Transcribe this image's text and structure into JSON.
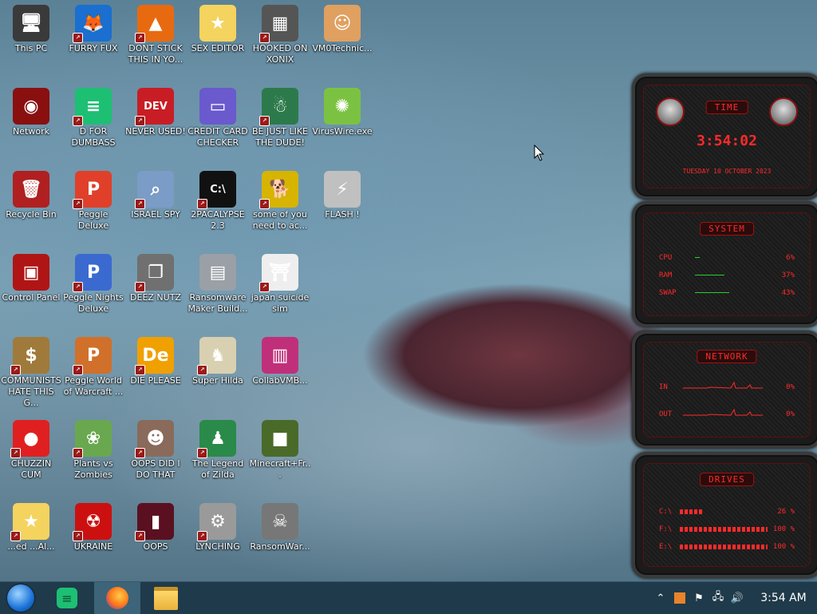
{
  "desktop": {
    "icons": [
      {
        "label": "This PC",
        "glyph": "🖥",
        "color": "#3a3a3a",
        "col": 0,
        "row": 0,
        "shortcut": false
      },
      {
        "label": "FURRY FUX",
        "glyph": "🦊",
        "color": "#1a6fd0",
        "col": 1,
        "row": 0,
        "shortcut": true
      },
      {
        "label": "DONT STICK THIS IN YO...",
        "glyph": "▲",
        "color": "#e86a10",
        "col": 2,
        "row": 0,
        "shortcut": true
      },
      {
        "label": "SEX EDITOR",
        "glyph": "★",
        "color": "#f4d35e",
        "col": 3,
        "row": 0,
        "shortcut": false
      },
      {
        "label": "HOOKED ON XONIX",
        "glyph": "▦",
        "color": "#555555",
        "col": 4,
        "row": 0,
        "shortcut": true
      },
      {
        "label": "VM0Technic...",
        "glyph": "☺",
        "color": "#e0a060",
        "col": 5,
        "row": 0,
        "shortcut": false
      },
      {
        "label": "Network",
        "glyph": "◉",
        "color": "#8a1010",
        "col": 0,
        "row": 1,
        "shortcut": false
      },
      {
        "label": "D FOR DUMBASS",
        "glyph": "≡",
        "color": "#1dbf73",
        "col": 1,
        "row": 1,
        "shortcut": true
      },
      {
        "label": "NEVER USED!",
        "glyph": "DEV",
        "color": "#c81d25",
        "col": 2,
        "row": 1,
        "shortcut": true
      },
      {
        "label": "CREDIT CARD CHECKER",
        "glyph": "▭",
        "color": "#6a5acd",
        "col": 3,
        "row": 1,
        "shortcut": false
      },
      {
        "label": "BE JUST LIKE THE DUDE!",
        "glyph": "☃",
        "color": "#2c7a4b",
        "col": 4,
        "row": 1,
        "shortcut": true
      },
      {
        "label": "VirusWire.exe",
        "glyph": "✺",
        "color": "#7cc242",
        "col": 5,
        "row": 1,
        "shortcut": false
      },
      {
        "label": "Recycle Bin",
        "glyph": "🗑",
        "color": "#b02020",
        "col": 0,
        "row": 2,
        "shortcut": false
      },
      {
        "label": "Peggle Deluxe",
        "glyph": "P",
        "color": "#e0402a",
        "col": 1,
        "row": 2,
        "shortcut": true
      },
      {
        "label": "ISRAEL SPY",
        "glyph": "⌕",
        "color": "#7a9cc6",
        "col": 2,
        "row": 2,
        "shortcut": true
      },
      {
        "label": "2PACALYPSE 2.3",
        "glyph": "C:\\",
        "color": "#111111",
        "col": 3,
        "row": 2,
        "shortcut": true
      },
      {
        "label": "some of you need to ac...",
        "glyph": "🐕",
        "color": "#d6b400",
        "col": 4,
        "row": 2,
        "shortcut": true
      },
      {
        "label": "FLASH !",
        "glyph": "⚡",
        "color": "#c0c0c0",
        "col": 5,
        "row": 2,
        "shortcut": false
      },
      {
        "label": "Control Panel",
        "glyph": "▣",
        "color": "#b01515",
        "col": 0,
        "row": 3,
        "shortcut": false
      },
      {
        "label": "Peggle Nights Deluxe",
        "glyph": "P",
        "color": "#3a6ad0",
        "col": 1,
        "row": 3,
        "shortcut": true
      },
      {
        "label": "DEEZ NUTZ",
        "glyph": "❐",
        "color": "#707070",
        "col": 2,
        "row": 3,
        "shortcut": true
      },
      {
        "label": "Ransomware Maker Build...",
        "glyph": "▤",
        "color": "#9aa0a6",
        "col": 3,
        "row": 3,
        "shortcut": false
      },
      {
        "label": "japan suicide sim",
        "glyph": "⛩",
        "color": "#eeeeee",
        "col": 4,
        "row": 3,
        "shortcut": true
      },
      {
        "label": "COMMUNISTS HATE THIS G...",
        "glyph": "$",
        "color": "#a07a3a",
        "col": 0,
        "row": 4,
        "shortcut": true
      },
      {
        "label": "Peggle World of Warcraft ...",
        "glyph": "P",
        "color": "#d0702a",
        "col": 1,
        "row": 4,
        "shortcut": true
      },
      {
        "label": "DIE PLEASE",
        "glyph": "De",
        "color": "#f0a000",
        "col": 2,
        "row": 4,
        "shortcut": true
      },
      {
        "label": "Super Hilda",
        "glyph": "♞",
        "color": "#d8d0b0",
        "col": 3,
        "row": 4,
        "shortcut": true
      },
      {
        "label": "CollabVMB...",
        "glyph": "▥",
        "color": "#c0307a",
        "col": 4,
        "row": 4,
        "shortcut": false
      },
      {
        "label": "CHUZZIN CUM",
        "glyph": "●",
        "color": "#e02020",
        "col": 0,
        "row": 5,
        "shortcut": true
      },
      {
        "label": "Plants vs Zombies",
        "glyph": "❀",
        "color": "#6aa84f",
        "col": 1,
        "row": 5,
        "shortcut": true
      },
      {
        "label": "OOPS DID I DO THAT",
        "glyph": "☻",
        "color": "#8a6a5a",
        "col": 2,
        "row": 5,
        "shortcut": true
      },
      {
        "label": "The Legend of Zilda",
        "glyph": "♟",
        "color": "#2a8a4a",
        "col": 3,
        "row": 5,
        "shortcut": true
      },
      {
        "label": "Minecraft+Fr...",
        "glyph": "■",
        "color": "#4a6a2a",
        "col": 4,
        "row": 5,
        "shortcut": false
      },
      {
        "label": "...ed ...Al...",
        "glyph": "★",
        "color": "#f4d35e",
        "col": 0,
        "row": 6,
        "shortcut": true
      },
      {
        "label": "UKRAINE",
        "glyph": "☢",
        "color": "#cc1010",
        "col": 1,
        "row": 6,
        "shortcut": true
      },
      {
        "label": "OOPS",
        "glyph": "▮",
        "color": "#5a1020",
        "col": 2,
        "row": 6,
        "shortcut": true
      },
      {
        "label": "LYNCHING",
        "glyph": "⚙",
        "color": "#9a9a9a",
        "col": 3,
        "row": 6,
        "shortcut": true
      },
      {
        "label": "RansomWar...",
        "glyph": "☠",
        "color": "#777777",
        "col": 4,
        "row": 6,
        "shortcut": false
      }
    ]
  },
  "widget": {
    "time": {
      "title": "TIME",
      "clock": "3:54:02",
      "date": "TUESDAY 10 OCTOBER 2023"
    },
    "system": {
      "title": "SYSTEM",
      "rows": [
        {
          "label": "CPU",
          "value": "6%",
          "level": 0.06
        },
        {
          "label": "RAM",
          "value": "37%",
          "level": 0.37
        },
        {
          "label": "SWAP",
          "value": "43%",
          "level": 0.43
        }
      ]
    },
    "network": {
      "title": "NETWORK",
      "rows": [
        {
          "label": "IN",
          "value": "0%"
        },
        {
          "label": "OUT",
          "value": "0%"
        }
      ]
    },
    "drives": {
      "title": "DRIVES",
      "rows": [
        {
          "label": "C:\\",
          "value": "26 %",
          "level": 0.26
        },
        {
          "label": "F:\\",
          "value": "100 %",
          "level": 1.0
        },
        {
          "label": "E:\\",
          "value": "100 %",
          "level": 1.0
        }
      ]
    }
  },
  "taskbar": {
    "apps": [
      {
        "name": "start-orb"
      },
      {
        "name": "d-for-dumbass-app"
      },
      {
        "name": "firefox-app"
      },
      {
        "name": "file-explorer-app"
      }
    ],
    "tray": {
      "clock": "3:54 AM"
    }
  },
  "colors": {
    "accent": "#ff2a2a",
    "taskbar": "#1f3a4a"
  }
}
